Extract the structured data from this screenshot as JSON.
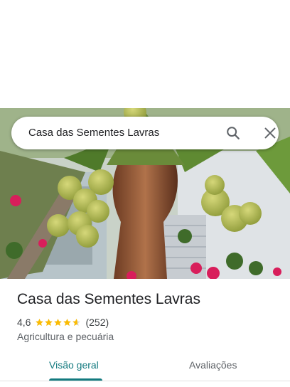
{
  "search": {
    "query": "Casa das Sementes Lavras"
  },
  "place": {
    "name": "Casa das Sementes Lavras",
    "rating_value": "4,6",
    "rating_stars": 4.6,
    "review_count": "(252)",
    "category": "Agricultura e pecuária"
  },
  "tabs": [
    {
      "label": "Visão geral",
      "selected": true
    },
    {
      "label": "Avaliações",
      "selected": false
    }
  ],
  "colors": {
    "accent": "#137a7f",
    "star": "#fbbc04",
    "star_empty": "#dadce0"
  },
  "icons": {
    "search": "search-icon",
    "close": "close-icon"
  }
}
